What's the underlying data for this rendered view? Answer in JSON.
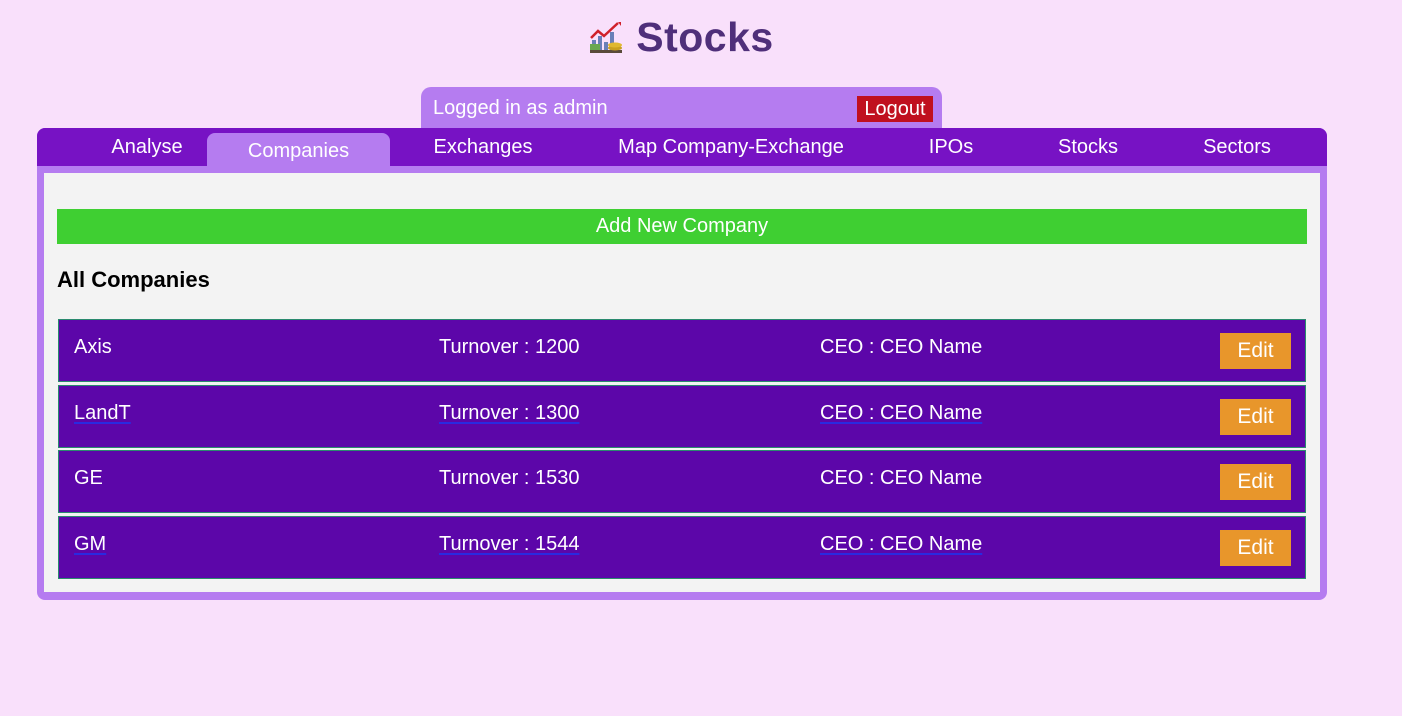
{
  "header": {
    "title": "Stocks",
    "logo_icon": "stock-chart-icon"
  },
  "userbar": {
    "logged_in_text": "Logged in as admin",
    "logout_label": "Logout"
  },
  "tabs": [
    {
      "label": "Analyse",
      "active": false
    },
    {
      "label": "Companies",
      "active": true
    },
    {
      "label": "Exchanges",
      "active": false
    },
    {
      "label": "Map Company-Exchange",
      "active": false
    },
    {
      "label": "IPOs",
      "active": false
    },
    {
      "label": "Stocks",
      "active": false
    },
    {
      "label": "Sectors",
      "active": false
    }
  ],
  "main": {
    "add_button_label": "Add New Company",
    "section_title": "All Companies",
    "edit_label": "Edit",
    "companies": [
      {
        "name": "Axis",
        "turnover": "Turnover : 1200",
        "ceo": "CEO : CEO Name"
      },
      {
        "name": "LandT",
        "turnover": "Turnover : 1300",
        "ceo": "CEO : CEO Name"
      },
      {
        "name": "GE",
        "turnover": "Turnover : 1530",
        "ceo": "CEO : CEO Name"
      },
      {
        "name": "GM",
        "turnover": "Turnover : 1544",
        "ceo": "CEO : CEO Name"
      }
    ]
  },
  "colors": {
    "page_bg": "#f9e0fb",
    "tab_bar": "#7712c4",
    "panel": "#b57cf0",
    "row_bg": "#5c06a9",
    "add_button": "#3fcf32",
    "edit_button": "#e8962b",
    "logout_button": "#c0101e",
    "title": "#4f2f7a"
  }
}
